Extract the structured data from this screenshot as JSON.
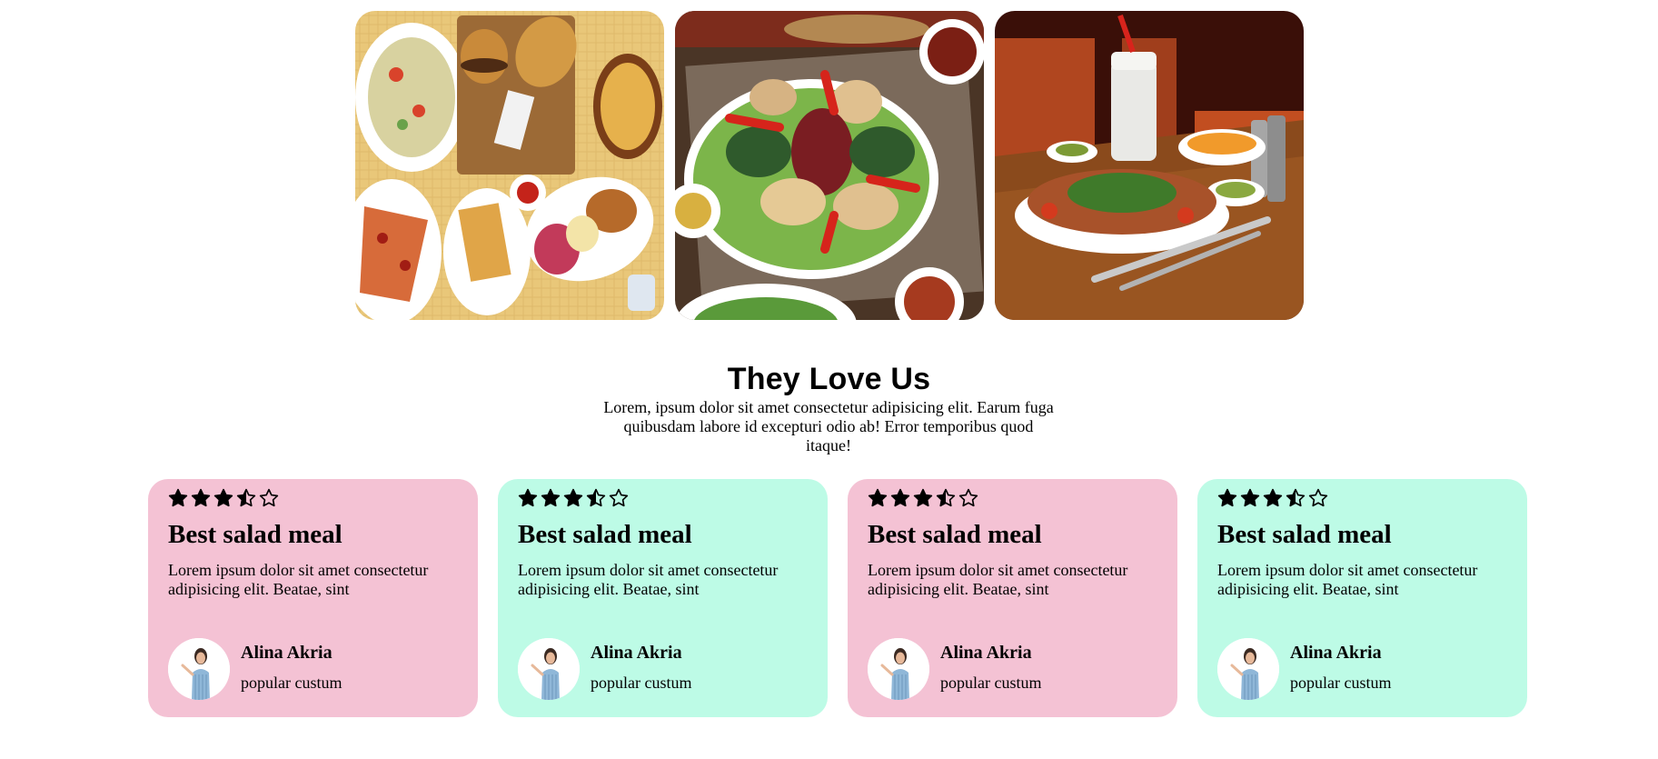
{
  "gallery": {
    "images": [
      {
        "alt": "fast food platter"
      },
      {
        "alt": "kebab plate"
      },
      {
        "alt": "restaurant table dish"
      }
    ]
  },
  "section": {
    "title": "They Love Us",
    "description": "Lorem, ipsum dolor sit amet consectetur adipisicing elit. Earum fuga quibusdam labore id excepturi odio ab! Error temporibus quod itaque!"
  },
  "colors": {
    "pink": "#f4c2d4",
    "mint": "#bdfbe6"
  },
  "testimonials": [
    {
      "rating": 3.5,
      "title": "Best salad meal",
      "text": "Lorem ipsum dolor sit amet consectetur adipisicing elit. Beatae, sint",
      "name": "Alina Akria",
      "role": "popular custum",
      "color": "pink"
    },
    {
      "rating": 3.5,
      "title": "Best salad meal",
      "text": "Lorem ipsum dolor sit amet consectetur adipisicing elit. Beatae, sint",
      "name": "Alina Akria",
      "role": "popular custum",
      "color": "mint"
    },
    {
      "rating": 3.5,
      "title": "Best salad meal",
      "text": "Lorem ipsum dolor sit amet consectetur adipisicing elit. Beatae, sint",
      "name": "Alina Akria",
      "role": "popular custum",
      "color": "pink"
    },
    {
      "rating": 3.5,
      "title": "Best salad meal",
      "text": "Lorem ipsum dolor sit amet consectetur adipisicing elit. Beatae, sint",
      "name": "Alina Akria",
      "role": "popular custum",
      "color": "mint"
    }
  ]
}
